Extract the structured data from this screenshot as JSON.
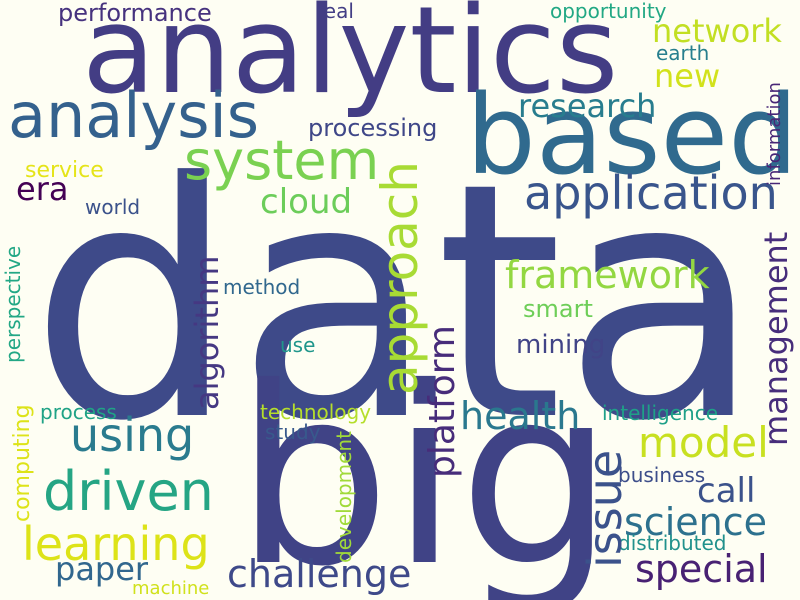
{
  "background": "#fefef3",
  "words": {
    "data": {
      "text": "data",
      "color": "#3e4a89"
    },
    "big": {
      "text": "big",
      "color": "#404386"
    },
    "analytics": {
      "text": "analytics",
      "color": "#433d84"
    },
    "based": {
      "text": "based",
      "color": "#306a8e"
    },
    "analysis": {
      "text": "analysis",
      "color": "#34618d"
    },
    "system": {
      "text": "system",
      "color": "#7ad151"
    },
    "application": {
      "text": "application",
      "color": "#39558c"
    },
    "approach": {
      "text": "approach",
      "color": "#a8db34"
    },
    "framework": {
      "text": "framework",
      "color": "#93d741"
    },
    "driven": {
      "text": "driven",
      "color": "#25a584"
    },
    "using": {
      "text": "using",
      "color": "#2a7b8e"
    },
    "learning": {
      "text": "learning",
      "color": "#dde318"
    },
    "challenge": {
      "text": "challenge",
      "color": "#3e4989"
    },
    "model": {
      "text": "model",
      "color": "#c8e020"
    },
    "science": {
      "text": "science",
      "color": "#2d718e"
    },
    "special": {
      "text": "special",
      "color": "#482173"
    },
    "health": {
      "text": "health",
      "color": "#2a788e"
    },
    "issue": {
      "text": "issue",
      "color": "#3b528b"
    },
    "platform": {
      "text": "platform",
      "color": "#472c7a"
    },
    "management": {
      "text": "management",
      "color": "#472d7b"
    },
    "algorithm": {
      "text": "algorithm",
      "color": "#453882"
    },
    "network": {
      "text": "network",
      "color": "#c2df23"
    },
    "new": {
      "text": "new",
      "color": "#d2e21b"
    },
    "research": {
      "text": "research",
      "color": "#287d8e"
    },
    "performance": {
      "text": "performance",
      "color": "#46327e"
    },
    "processing": {
      "text": "processing",
      "color": "#3f4788"
    },
    "cloud": {
      "text": "cloud",
      "color": "#6ccd5a"
    },
    "era": {
      "text": "era",
      "color": "#440154"
    },
    "call": {
      "text": "call",
      "color": "#3b528b"
    },
    "paper": {
      "text": "paper",
      "color": "#31678e"
    },
    "mining": {
      "text": "mining",
      "color": "#414487"
    },
    "smart": {
      "text": "smart",
      "color": "#6ece58"
    },
    "service": {
      "text": "service",
      "color": "#e5e419"
    },
    "world": {
      "text": "world",
      "color": "#3b528b"
    },
    "method": {
      "text": "method",
      "color": "#31688e"
    },
    "use": {
      "text": "use",
      "color": "#1f968b"
    },
    "process": {
      "text": "process",
      "color": "#20a386"
    },
    "technology": {
      "text": "technology",
      "color": "#b5de2b"
    },
    "study": {
      "text": "study",
      "color": "#38598c"
    },
    "intelligence": {
      "text": "intelligence",
      "color": "#1fa088"
    },
    "business": {
      "text": "business",
      "color": "#3d4e8a"
    },
    "distributed": {
      "text": "distributed",
      "color": "#21918c"
    },
    "machine": {
      "text": "machine",
      "color": "#d0e11c"
    },
    "opportunity": {
      "text": "opportunity",
      "color": "#22a884"
    },
    "real": {
      "text": "real",
      "color": "#433e85"
    },
    "earth": {
      "text": "earth",
      "color": "#277f8e"
    },
    "information": {
      "text": "information",
      "color": "#482677"
    },
    "perspective": {
      "text": "perspective",
      "color": "#22a785"
    },
    "computing": {
      "text": "computing",
      "color": "#dde318"
    },
    "development": {
      "text": "development",
      "color": "#a0da39"
    }
  }
}
